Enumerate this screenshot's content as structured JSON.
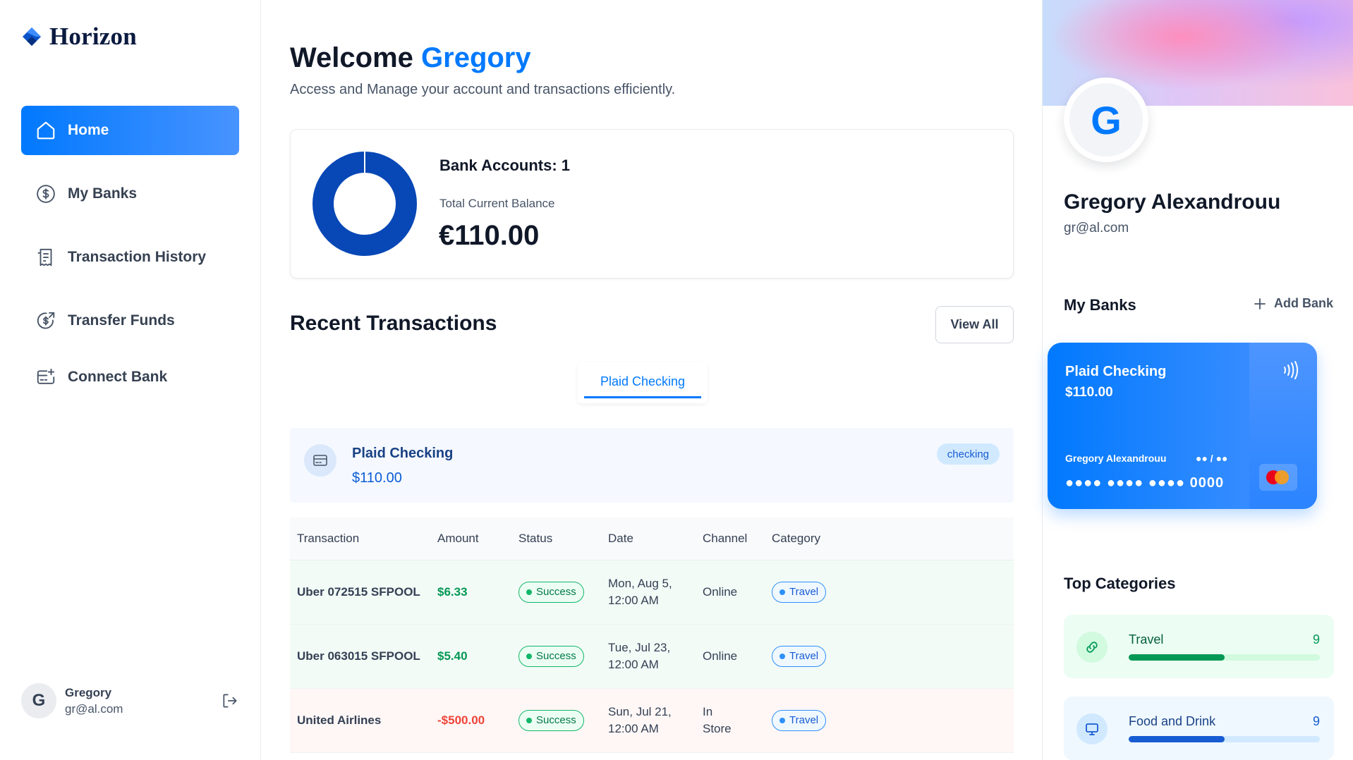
{
  "app": {
    "name": "Horizon"
  },
  "sidebar": {
    "items": [
      {
        "label": "Home",
        "icon": "home-icon",
        "active": true
      },
      {
        "label": "My Banks",
        "icon": "dollar-circle-icon",
        "active": false
      },
      {
        "label": "Transaction History",
        "icon": "receipt-icon",
        "active": false
      },
      {
        "label": "Transfer Funds",
        "icon": "money-send-icon",
        "active": false
      },
      {
        "label": "Connect Bank",
        "icon": "card-add-icon",
        "active": false
      }
    ],
    "user": {
      "initial": "G",
      "name": "Gregory",
      "email": "gr@al.com"
    }
  },
  "header": {
    "welcome": "Welcome",
    "name": "Gregory",
    "subtitle": "Access and Manage your account and transactions efficiently."
  },
  "balance": {
    "accounts_label": "Bank Accounts: 1",
    "total_label": "Total Current Balance",
    "total_value": "€110.00",
    "donut_share": 1.0,
    "donut_color": "#0747b6"
  },
  "transactions": {
    "title": "Recent Transactions",
    "view_all": "View All",
    "tab": "Plaid Checking",
    "bank": {
      "name": "Plaid Checking",
      "balance": "$110.00",
      "type": "checking"
    },
    "columns": [
      "Transaction",
      "Amount",
      "Status",
      "Date",
      "Channel",
      "Category"
    ],
    "rows": [
      {
        "name": "Uber 072515 SFPOOL",
        "amount": "$6.33",
        "status": "Success",
        "date_line1": "Mon, Aug 5,",
        "date_line2": "12:00 AM",
        "channel_line1": "Online",
        "channel_line2": "",
        "category": "Travel",
        "kind": "pos"
      },
      {
        "name": "Uber 063015 SFPOOL",
        "amount": "$5.40",
        "status": "Success",
        "date_line1": "Tue, Jul 23,",
        "date_line2": "12:00 AM",
        "channel_line1": "Online",
        "channel_line2": "",
        "category": "Travel",
        "kind": "pos"
      },
      {
        "name": "United Airlines",
        "amount": "-$500.00",
        "status": "Success",
        "date_line1": "Sun, Jul 21,",
        "date_line2": "12:00 AM",
        "channel_line1": "In",
        "channel_line2": "Store",
        "category": "Travel",
        "kind": "neg"
      }
    ]
  },
  "profile": {
    "initial": "G",
    "name": "Gregory Alexandrouu",
    "email": "gr@al.com"
  },
  "my_banks": {
    "title": "My Banks",
    "add_label": "Add Bank",
    "card": {
      "bank_name": "Plaid Checking",
      "balance": "$110.00",
      "holder": "Gregory Alexandrouu",
      "expiry": "●● / ●●",
      "number": "●●●● ●●●● ●●●● 0000"
    }
  },
  "top_categories": {
    "title": "Top Categories",
    "items": [
      {
        "name": "Travel",
        "count": "9",
        "progress": 0.5
      },
      {
        "name": "Food and Drink",
        "count": "9",
        "progress": 0.5
      }
    ]
  }
}
